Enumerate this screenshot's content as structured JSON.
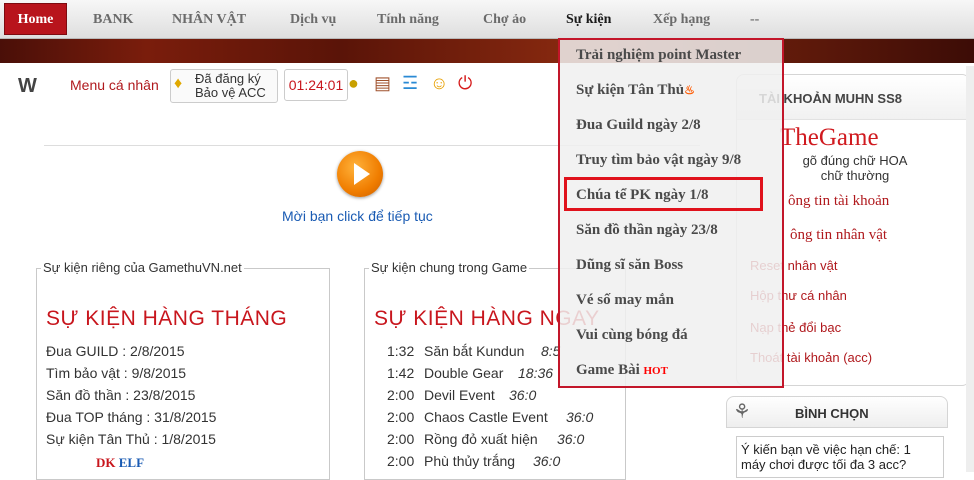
{
  "nav": {
    "home": "Home",
    "items": [
      "BANK",
      "NHÂN VẬT",
      "Dịch vụ",
      "Tính năng",
      "Chợ ảo",
      "Sự kiện",
      "Xếp hạng",
      "--"
    ],
    "active": "Sự kiện"
  },
  "toolbar": {
    "menu_label": "Menu cá nhân",
    "registered_line1": "Đã đăng ký",
    "registered_line2": "Bảo vệ ACC",
    "clock": "01:24:01",
    "icons": [
      "money-bag-icon",
      "treasure-chest-icon",
      "shopping-cart-icon",
      "smiley-icon",
      "power-icon"
    ]
  },
  "main": {
    "click_text": "Mời bạn click để tiếp tục"
  },
  "private_events": {
    "legend": "Sự kiện riêng của GamethuVN.net",
    "heading": "SỰ KIỆN HÀNG THÁNG",
    "lines": [
      "Đua GUILD : 2/8/2015",
      "Tìm bảo vật : 9/8/2015",
      "Săn đồ thần : 23/8/2015",
      "Đua TOP tháng : 31/8/2015",
      "Sự kiện Tân Thủ : 1/8/2015"
    ],
    "logo_text": "DK ELF"
  },
  "common_events": {
    "legend": "Sự kiện chung trong Game",
    "heading": "SỰ KIỆN HÀNG NGAY",
    "schedule": [
      {
        "time": "1:32",
        "name": "Săn bắt Kundun",
        "count": "8:5"
      },
      {
        "time": "1:42",
        "name": "Double Gear",
        "count": "18:36"
      },
      {
        "time": "2:00",
        "name": "Devil Event",
        "count": "36:0"
      },
      {
        "time": "2:00",
        "name": "Chaos Castle Event",
        "count": "36:0"
      },
      {
        "time": "2:00",
        "name": "Rồng đỏ xuất hiện",
        "count": "36:0"
      },
      {
        "time": "2:00",
        "name": "Phù thủy trắng",
        "count": "36:0"
      }
    ]
  },
  "dropdown": {
    "items": [
      "Trải nghiệm point Master",
      "Sự kiện Tân Thủ",
      "Đua Guild ngày 2/8",
      "Truy tìm bảo vật ngày 9/8",
      "Chúa tể PK ngày 1/8",
      "Săn đồ thần ngày 23/8",
      "Dũng sĩ săn Boss",
      "Vé số may mắn",
      "Vui cùng bóng đá",
      "Game Bài"
    ],
    "hot_badge": "HOT",
    "highlighted": "Chúa tể PK ngày 1/8"
  },
  "sidebar": {
    "title": "TÀI KHOẢN MUHN SS8",
    "brand": "TheGame",
    "hint_line1": "gõ đúng chữ HOA",
    "hint_line2": "chữ thường",
    "links": [
      "ông tin tài khoản",
      "ông tin nhân vật",
      "Reset nhân vật",
      "Hộp thư cá nhân",
      "Nạp thẻ đổi bạc",
      "Thoát tài khoản (acc)"
    ]
  },
  "poll": {
    "title": "BÌNH CHỌN",
    "question_line1": "Ý kiến bạn về việc hạn chế: 1",
    "question_line2": "máy chơi được tối đa 3 acc?"
  },
  "colors": {
    "brand_red": "#c8161d",
    "link_blue": "#1a5bb3",
    "highlight_red": "#e0121c"
  }
}
